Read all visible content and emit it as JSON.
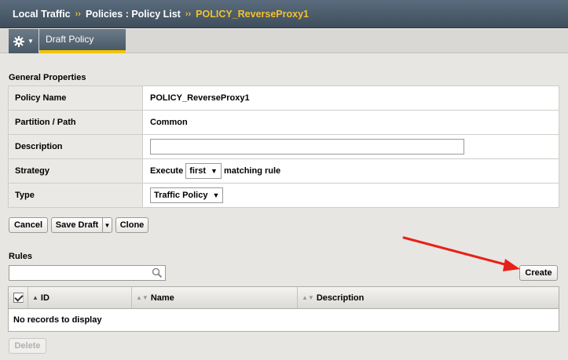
{
  "breadcrumb": {
    "items": [
      "Local Traffic",
      "Policies : Policy List",
      "POLICY_ReverseProxy1"
    ],
    "separator": "››"
  },
  "tabs": {
    "gear_menu_icon": "gear-icon",
    "active_tab": "Draft Policy"
  },
  "general": {
    "title": "General Properties",
    "policy_name_label": "Policy Name",
    "policy_name_value": "POLICY_ReverseProxy1",
    "partition_label": "Partition / Path",
    "partition_value": "Common",
    "description_label": "Description",
    "description_value": "",
    "strategy_label": "Strategy",
    "strategy_prefix": "Execute",
    "strategy_selected": "first",
    "strategy_suffix": "matching rule",
    "type_label": "Type",
    "type_selected": "Traffic Policy"
  },
  "actions": {
    "cancel": "Cancel",
    "save_draft": "Save Draft",
    "clone": "Clone"
  },
  "rules": {
    "title": "Rules",
    "search_placeholder": "",
    "create": "Create",
    "columns": [
      "ID",
      "Name",
      "Description"
    ],
    "empty_text": "No records to display",
    "delete": "Delete"
  },
  "colors": {
    "accent": "#f2c500",
    "annotation_arrow": "#e8201a"
  }
}
